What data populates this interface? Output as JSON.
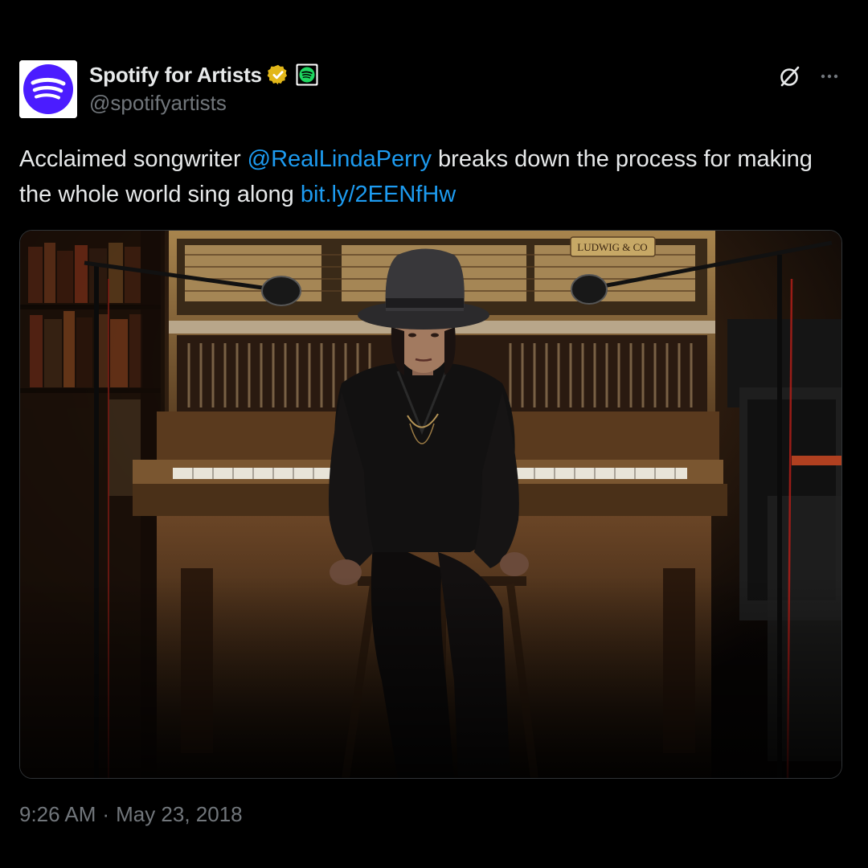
{
  "account": {
    "display_name": "Spotify for Artists",
    "handle": "@spotifyartists",
    "verified_badge": "verified-badge-gold",
    "affiliate_icon": "spotify-logo",
    "avatar_icon": "spotify-for-artists-logo",
    "avatar_color": "#4b1cff"
  },
  "actions": {
    "grok_icon": "grok-icon",
    "more_icon": "more-dots-icon"
  },
  "tweet": {
    "text_part1": "Acclaimed songwriter ",
    "mention": "@RealLindaPerry",
    "text_part2": " breaks down the process for making the whole world sing along ",
    "link": "bit.ly/2EENfHw"
  },
  "media": {
    "piano_brand_text": "LUDWIG & CO"
  },
  "timestamp": {
    "time": "9:26 AM",
    "separator": "·",
    "date": "May 23, 2018"
  },
  "colors": {
    "background": "#000000",
    "primary_text": "#e7e9ea",
    "secondary_text": "#71767b",
    "link": "#1d9bf0",
    "badge_gold": "#e2b719",
    "spotify_green": "#1ed760"
  }
}
